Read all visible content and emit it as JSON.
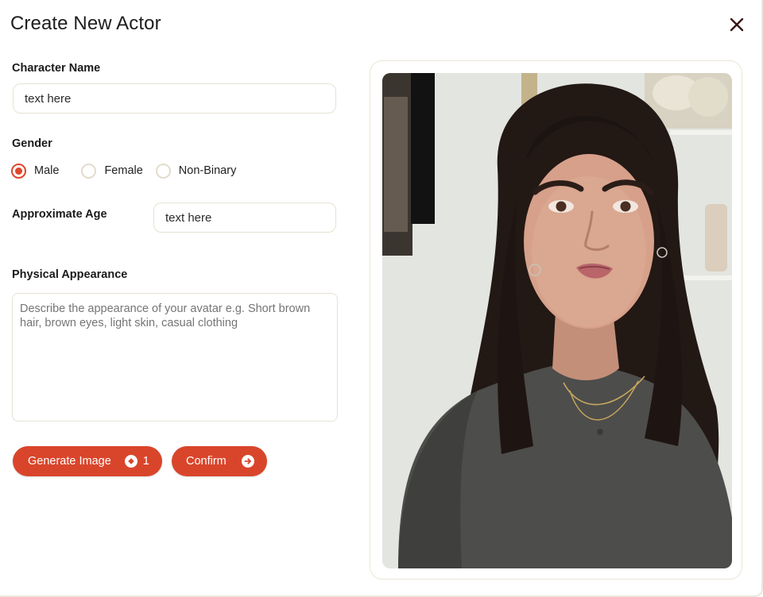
{
  "dialog": {
    "title": "Create New Actor"
  },
  "form": {
    "character_name": {
      "label": "Character Name",
      "value": "text here"
    },
    "gender": {
      "label": "Gender",
      "options": [
        "Male",
        "Female",
        "Non-Binary"
      ],
      "selected": "Male"
    },
    "age": {
      "label": "Approximate Age",
      "value": "text here"
    },
    "appearance": {
      "label": "Physical Appearance",
      "placeholder": "Describe the appearance of your avatar e.g. Short brown hair, brown eyes, light skin, casual clothing"
    }
  },
  "actions": {
    "generate_label": "Generate Image",
    "generate_cost": "1",
    "confirm_label": "Confirm"
  },
  "preview": {
    "image_icon": "portrait-photo"
  },
  "colors": {
    "accent": "#d9452b",
    "border": "#e6e1d3",
    "close_icon": "#3a1414"
  },
  "icons": {
    "close": "close-icon",
    "credit": "credit-coin-icon",
    "confirm": "arrow-right-circle-icon"
  }
}
